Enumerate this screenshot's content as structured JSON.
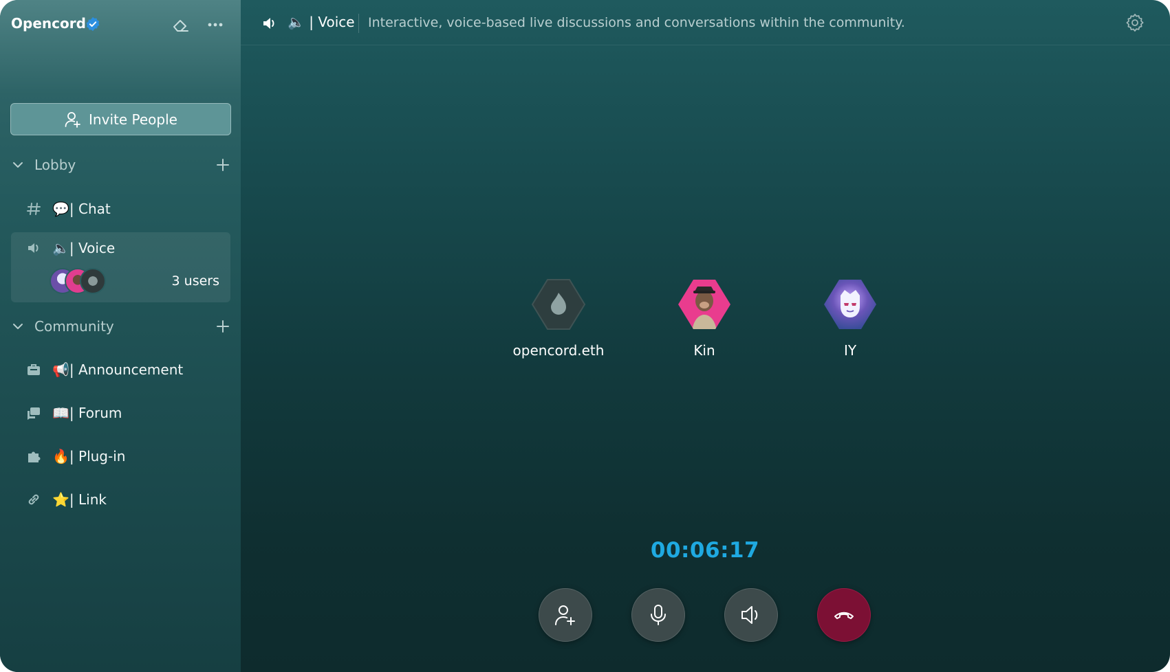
{
  "server": {
    "name": "Opencord"
  },
  "sidebar": {
    "invite_label": "Invite People",
    "categories": [
      {
        "label": "Lobby",
        "channels": [
          {
            "emoji": "💬",
            "label": "| Chat",
            "type": "text"
          },
          {
            "emoji": "🔈",
            "label": "| Voice",
            "type": "voice",
            "users_label": "3 users"
          }
        ]
      },
      {
        "label": "Community",
        "channels": [
          {
            "emoji": "📢",
            "label": "| Announcement",
            "type": "announcement"
          },
          {
            "emoji": "📖",
            "label": "| Forum",
            "type": "forum"
          },
          {
            "emoji": "🔥",
            "label": "| Plug-in",
            "type": "plugin"
          },
          {
            "emoji": "⭐",
            "label": "| Link",
            "type": "link"
          }
        ]
      }
    ]
  },
  "topbar": {
    "channel_emoji": "🔈",
    "channel_label": "| Voice",
    "description": "Interactive, voice-based live discussions and conversations within the community."
  },
  "call": {
    "participants": [
      {
        "name": "opencord.eth",
        "avatar": "flame-avatar"
      },
      {
        "name": "Kin",
        "avatar": "ape-avatar"
      },
      {
        "name": "IY",
        "avatar": "cosmic-avatar"
      }
    ],
    "timer": "00:06:17"
  },
  "colors": {
    "timer": "#1fa9e1",
    "hangup": "#7c1034",
    "verified": "#2b8fe0"
  }
}
